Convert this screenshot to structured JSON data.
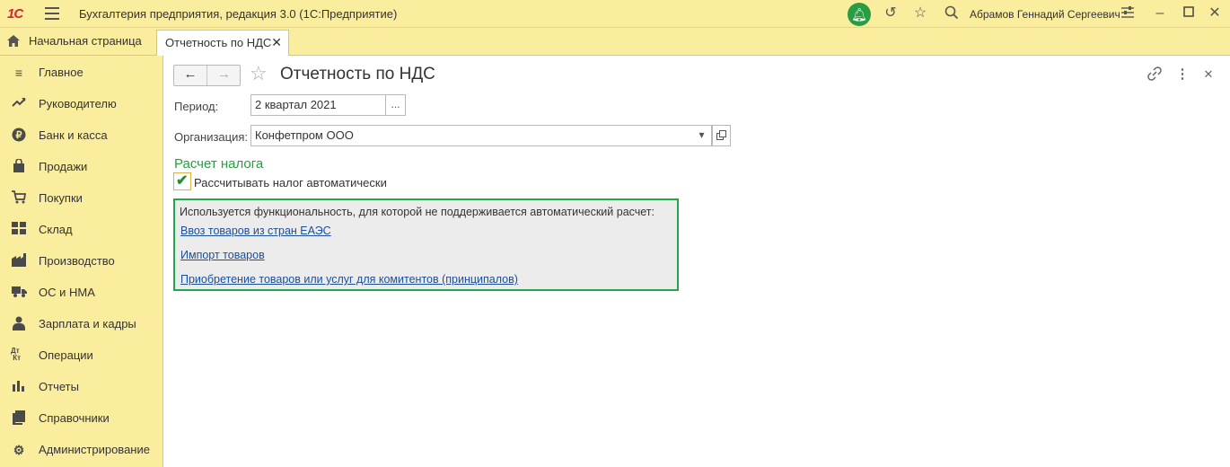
{
  "titlebar": {
    "logo": "1С",
    "app_title": "Бухгалтерия предприятия, редакция 3.0  (1С:Предприятие)",
    "user": "Абрамов Геннадий Сергеевич"
  },
  "tabs": {
    "home_label": "Начальная страница",
    "active_label": "Отчетность по НДС"
  },
  "sidebar": {
    "items": [
      {
        "label": "Главное",
        "icon": "menu-icon"
      },
      {
        "label": "Руководителю",
        "icon": "trend-icon"
      },
      {
        "label": "Банк и касса",
        "icon": "ruble-icon"
      },
      {
        "label": "Продажи",
        "icon": "bag-icon"
      },
      {
        "label": "Покупки",
        "icon": "cart-icon"
      },
      {
        "label": "Склад",
        "icon": "warehouse-icon"
      },
      {
        "label": "Производство",
        "icon": "factory-icon"
      },
      {
        "label": "ОС и НМА",
        "icon": "truck-icon"
      },
      {
        "label": "Зарплата и кадры",
        "icon": "person-icon"
      },
      {
        "label": "Операции",
        "icon": "dt-kt-icon"
      },
      {
        "label": "Отчеты",
        "icon": "bar-chart-icon"
      },
      {
        "label": "Справочники",
        "icon": "book-icon"
      },
      {
        "label": "Администрирование",
        "icon": "gear-icon"
      }
    ]
  },
  "form": {
    "title": "Отчетность по НДС",
    "period_label": "Период:",
    "period_value": "2 квартал 2021",
    "period_button": "...",
    "org_label": "Организация:",
    "org_value": "Конфетпром ООО",
    "section_title": "Расчет налога",
    "auto_calc_label": "Рассчитывать налог автоматически",
    "auto_calc_checked": true,
    "info_text": "Используется функциональность, для которой не поддерживается автоматический расчет:",
    "links": [
      "Ввоз товаров из стран ЕАЭС",
      "Импорт товаров",
      "Приобретение товаров или услуг для комитентов (принципалов)"
    ]
  },
  "colors": {
    "accent_green": "#2a9d42",
    "panel_yellow": "#fbed9e",
    "link_blue": "#1a4f9c",
    "highlight_border": "#22a84a"
  }
}
